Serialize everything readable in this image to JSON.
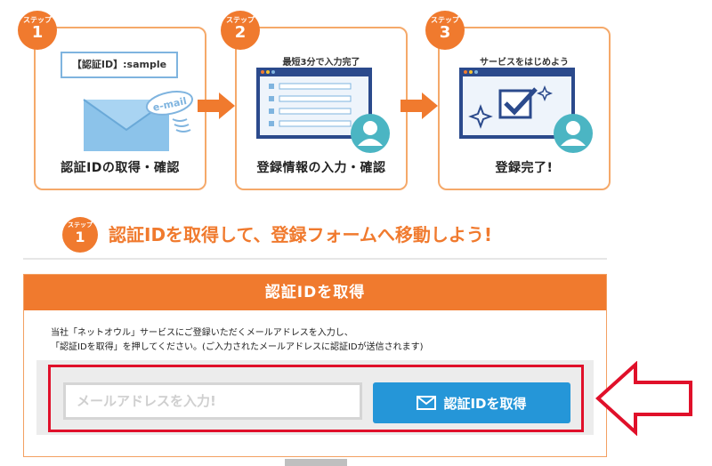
{
  "steps": [
    {
      "badge_label": "ステップ",
      "badge_number": "1",
      "caption": "認証IDの取得・確認",
      "id_box_text": "【認証ID】:sample",
      "mail_tag": "e-mail"
    },
    {
      "badge_label": "ステップ",
      "badge_number": "2",
      "caption": "登録情報の入力・確認",
      "note": "最短3分で入力完了"
    },
    {
      "badge_label": "ステップ",
      "badge_number": "3",
      "caption": "登録完了!",
      "note": "サービスをはじめよう"
    }
  ],
  "heading": {
    "badge_label": "ステップ",
    "badge_number": "1",
    "text": "認証IDを取得して、登録フォームへ移動しよう!"
  },
  "panel": {
    "title": "認証IDを取得",
    "description_line1": "当社「ネットオウル」サービスにご登録いただくメールアドレスを入力し、",
    "description_line2": "「認証IDを取得」を押してください。(ご入力されたメールアドレスに認証IDが送信されます)",
    "email_placeholder": "メールアドレスを入力!",
    "button_label": "認証IDを取得",
    "button_icon": "mail-icon"
  },
  "colors": {
    "accent_orange": "#f07a2e",
    "button_blue": "#2596d8",
    "highlight_red": "#e0102a",
    "screen_navy": "#2b4a8c"
  }
}
